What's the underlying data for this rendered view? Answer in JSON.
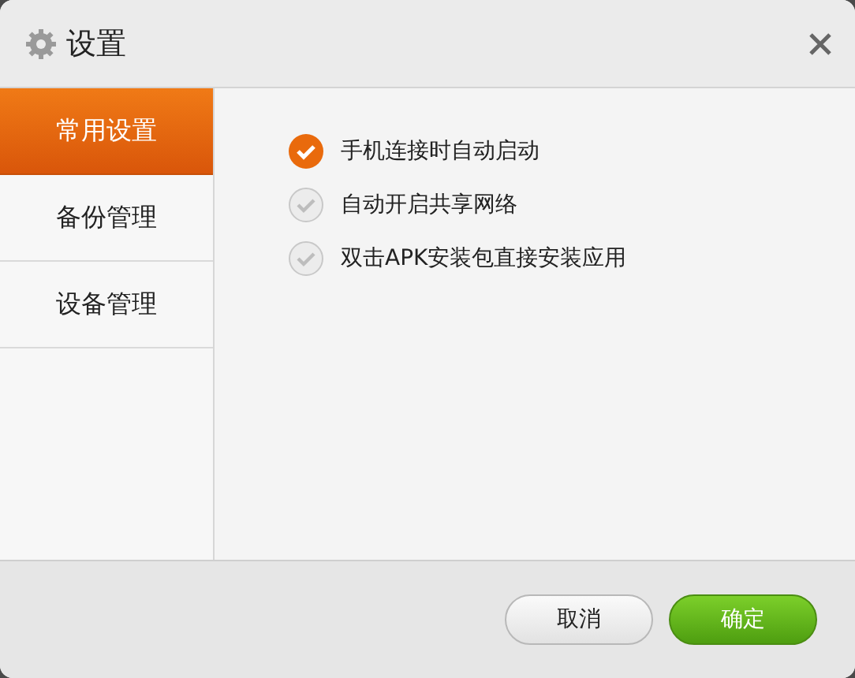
{
  "window": {
    "title": "设置"
  },
  "sidebar": {
    "items": [
      {
        "label": "常用设置",
        "selected": true
      },
      {
        "label": "备份管理",
        "selected": false
      },
      {
        "label": "设备管理",
        "selected": false
      }
    ]
  },
  "options": [
    {
      "label": "手机连接时自动启动",
      "checked": true
    },
    {
      "label": "自动开启共享网络",
      "checked": false
    },
    {
      "label": "双击APK安装包直接安装应用",
      "checked": false
    }
  ],
  "buttons": [
    {
      "label": "取消",
      "kind": "secondary"
    },
    {
      "label": "确定",
      "kind": "primary"
    }
  ]
}
